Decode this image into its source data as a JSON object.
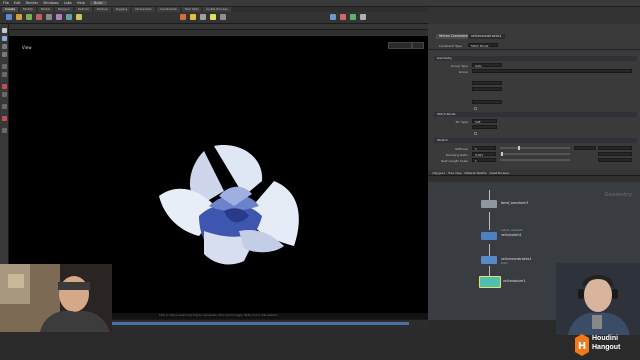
{
  "menu": {
    "items": [
      "File",
      "Edit",
      "Render",
      "Windows",
      "Labs",
      "Help"
    ],
    "desktop": "Build"
  },
  "shelf": {
    "tabs": [
      "Create",
      "Modify",
      "Model",
      "Polygon",
      "Deform",
      "Texture",
      "Rigging",
      "Characters",
      "Constraints",
      "Hair Utils",
      "Guide Process"
    ]
  },
  "viewport": {
    "label": "View",
    "status": "Click or drag to select and drag to manipulate. Ctrl+click to toggle, Shift+click to add selection."
  },
  "params": {
    "node_type": "Vellum Constraints",
    "node_name": "vellumconstraints1",
    "constraint_type_label": "Constraint Type",
    "constraint_type_value": "Stitch Points",
    "section_geometry": "Geometry",
    "group_type_label": "Group Type",
    "group_type_value": "Auto",
    "group_label": "Group",
    "section_stitch": "Stitch Points",
    "pin_type_label": "Pin Type",
    "pin_type_value": "Soft",
    "section_stretch": "Stretch",
    "stiffness_label": "Stiffness",
    "stiffness_value": "1",
    "damping_label": "Damping Ratio",
    "damping_value": "0.001",
    "rest_label": "Rest Length Scale",
    "rest_value": "1"
  },
  "network": {
    "tabs": [
      "/obj/geo1",
      "Tree View",
      "Material Palette",
      "Asset Browser"
    ],
    "context_label": "Geometry",
    "nodes": [
      {
        "label": "bend_transform3",
        "sub": ""
      },
      {
        "label": "vellumcloth1",
        "sub": "vellum_constraint"
      },
      {
        "label": "vellumconstraints1",
        "sub": "stitch"
      },
      {
        "label": "vellumsolver1",
        "sub": ""
      }
    ]
  },
  "logo": {
    "line1": "Houdini",
    "line2": "Hangout"
  },
  "colors": {
    "accent": "#3b87d8",
    "node_blue": "#4f7fbf",
    "node_teal": "#4fbfb0",
    "flower_light": "#e8eef8",
    "flower_shadow": "#2a3a8a"
  }
}
